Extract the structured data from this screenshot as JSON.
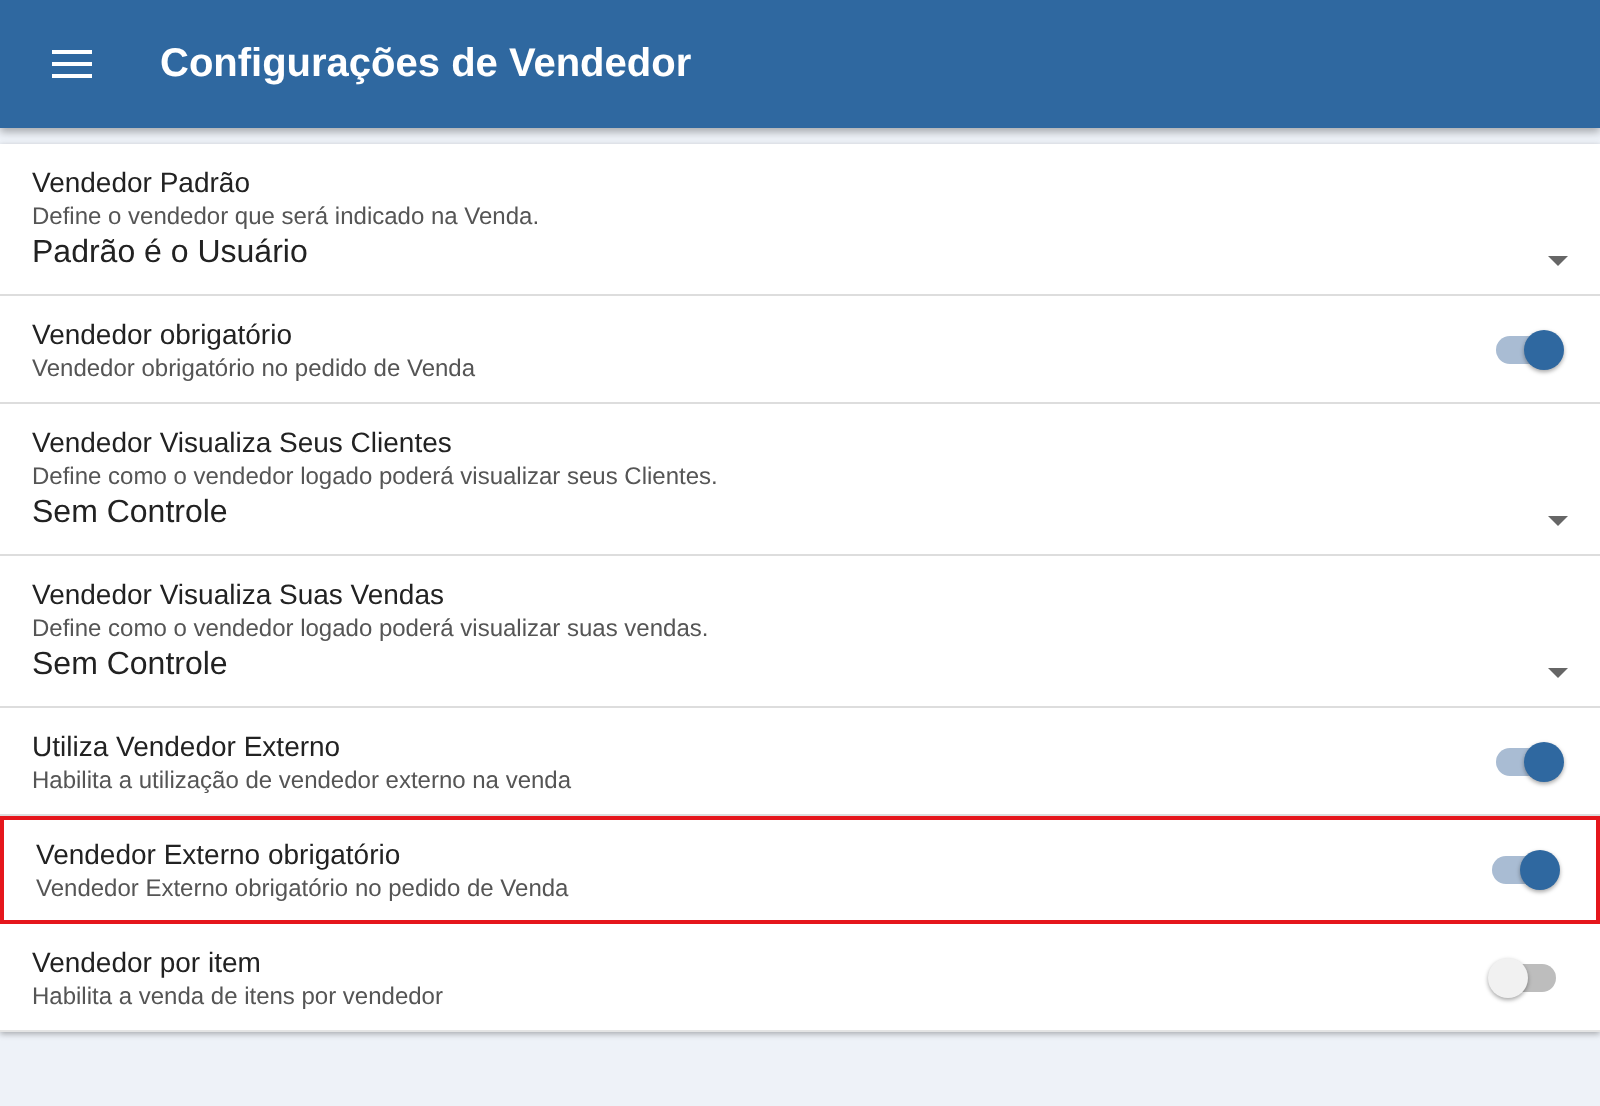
{
  "app_bar": {
    "title": "Configurações de Vendedor"
  },
  "settings": [
    {
      "kind": "select",
      "title": "Vendedor Padrão",
      "description": "Define o vendedor que será indicado na Venda.",
      "value": "Padrão é o Usuário",
      "highlighted": false
    },
    {
      "kind": "switch",
      "title": "Vendedor obrigatório",
      "description": "Vendedor obrigatório no pedido de Venda",
      "on": true,
      "highlighted": false
    },
    {
      "kind": "select",
      "title": "Vendedor Visualiza Seus Clientes",
      "description": "Define como o vendedor logado poderá visualizar seus Clientes.",
      "value": "Sem Controle",
      "highlighted": false
    },
    {
      "kind": "select",
      "title": "Vendedor Visualiza Suas Vendas",
      "description": "Define como o vendedor logado poderá visualizar suas vendas.",
      "value": "Sem Controle",
      "highlighted": false
    },
    {
      "kind": "switch",
      "title": "Utiliza Vendedor Externo",
      "description": "Habilita a utilização de vendedor externo na venda",
      "on": true,
      "highlighted": false
    },
    {
      "kind": "switch",
      "title": "Vendedor Externo obrigatório",
      "description": "Vendedor Externo obrigatório no pedido de Venda",
      "on": true,
      "highlighted": true
    },
    {
      "kind": "switch",
      "title": "Vendedor por item",
      "description": "Habilita a venda de itens por vendedor",
      "on": false,
      "highlighted": false
    }
  ]
}
